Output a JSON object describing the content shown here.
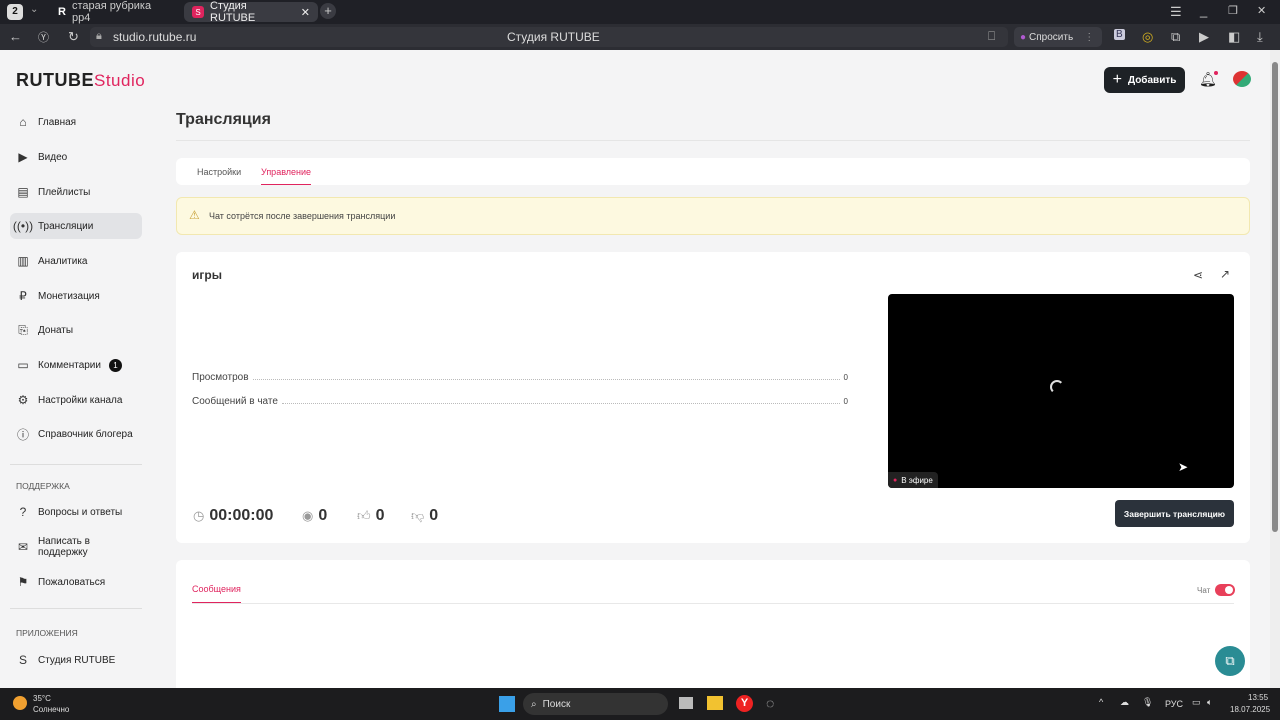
{
  "browser": {
    "tab_count": "2",
    "tabs": [
      {
        "label": "старая рубрика рр4"
      },
      {
        "label": "Студия RUTUBE"
      }
    ],
    "url": "studio.rutube.ru",
    "page_title": "Студия RUTUBE",
    "ask_label": "Спросить"
  },
  "header": {
    "logo_left": "RUTUBE",
    "logo_right": "Studio",
    "add_label": "Добавить"
  },
  "sidebar": {
    "items": [
      {
        "label": "Главная"
      },
      {
        "label": "Видео"
      },
      {
        "label": "Плейлисты"
      },
      {
        "label": "Трансляции"
      },
      {
        "label": "Аналитика"
      },
      {
        "label": "Монетизация"
      },
      {
        "label": "Донаты"
      },
      {
        "label": "Комментарии",
        "badge": "1"
      },
      {
        "label": "Настройки канала"
      },
      {
        "label": "Справочник блогера"
      }
    ],
    "support_title": "Поддержка",
    "support": [
      {
        "label": "Вопросы и ответы"
      },
      {
        "label": "Написать в поддержку"
      },
      {
        "label": "Пожаловаться"
      }
    ],
    "apps_title": "Приложения",
    "apps": [
      {
        "label": "Студия RUTUBE"
      }
    ]
  },
  "main": {
    "title": "Трансляция",
    "tabs": [
      {
        "label": "Настройки"
      },
      {
        "label": "Управление"
      }
    ],
    "warning": "Чат сотрётся после завершения трансляции",
    "stream": {
      "name": "игры",
      "stats": [
        {
          "label": "Просмотров",
          "value": "0"
        },
        {
          "label": "Сообщений в чате",
          "value": "0"
        }
      ],
      "timer": "00:00:00",
      "viewers": "0",
      "likes": "0",
      "dislikes": "0",
      "live_label": "В эфире",
      "end_label": "Завершить трансляцию"
    },
    "chat": {
      "tab": "Сообщения",
      "toggle_label": "Чат",
      "toggle_on": true
    }
  },
  "taskbar": {
    "temp": "35°C",
    "weather": "Солнечно",
    "search": "Поиск",
    "lang": "РУС",
    "time": "13:55",
    "date": "18.07.2025"
  },
  "colors": {
    "accent": "#e0245e",
    "dark": "#2b323b"
  }
}
